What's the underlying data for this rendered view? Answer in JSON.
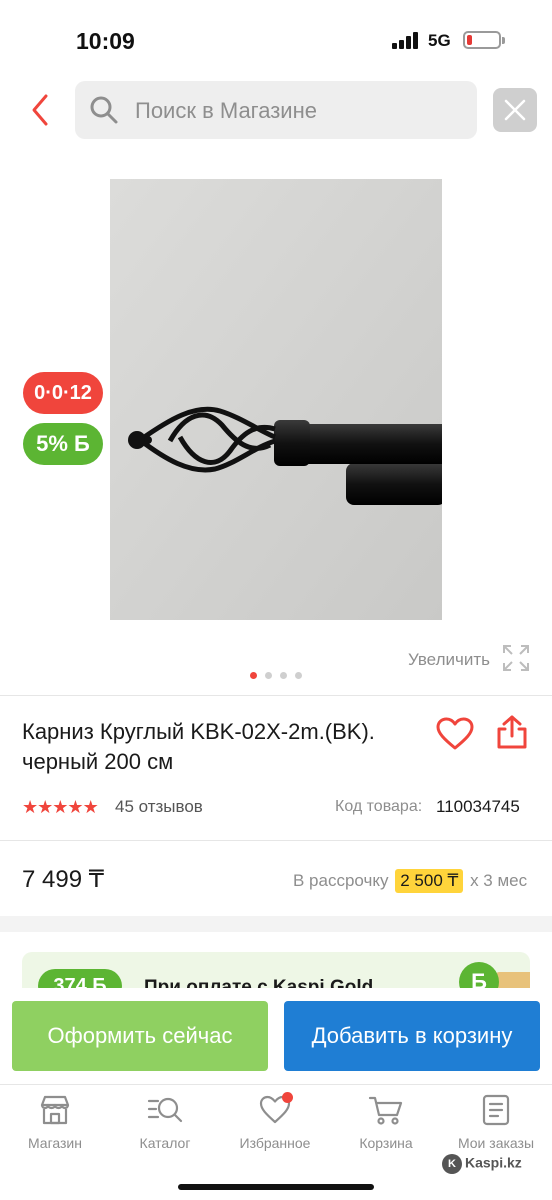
{
  "status_bar": {
    "time": "10:09",
    "network": "5G"
  },
  "search": {
    "placeholder": "Поиск в Магазине"
  },
  "product": {
    "badge_installment": "0·0·12",
    "badge_bonus": "5% Б",
    "image_dots": 4,
    "active_dot": 1,
    "zoom_label": "Увеличить",
    "title": "Карниз Круглый KBK-02X-2m.(BK). черный 200 см",
    "rating": 4.5,
    "reviews": "45 отзывов",
    "code_label": "Код товара:",
    "code_value": "110034745",
    "price": "7 499 ₸",
    "installment_prefix": "В рассрочку",
    "installment_amount": "2 500 ₸",
    "installment_suffix": "х 3 мес"
  },
  "promo": {
    "badge": "374 Б",
    "text": "При оплате с Kaspi Gold"
  },
  "actions": {
    "checkout_label": "Оформить сейчас",
    "add_to_cart_label": "Добавить в корзину"
  },
  "tabs": [
    {
      "label": "Магазин",
      "icon": "shop-icon"
    },
    {
      "label": "Каталог",
      "icon": "catalog-search-icon"
    },
    {
      "label": "Избранное",
      "icon": "heart-icon"
    },
    {
      "label": "Корзина",
      "icon": "cart-icon"
    },
    {
      "label": "Мои заказы",
      "icon": "orders-icon"
    }
  ],
  "watermark": "Kaspi.kz",
  "colors": {
    "accent_red": "#f0453c",
    "bonus_green": "#5cb533",
    "checkout_green": "#8fd061",
    "cart_blue": "#1f7ed4",
    "installment_yellow": "#ffd43b"
  }
}
